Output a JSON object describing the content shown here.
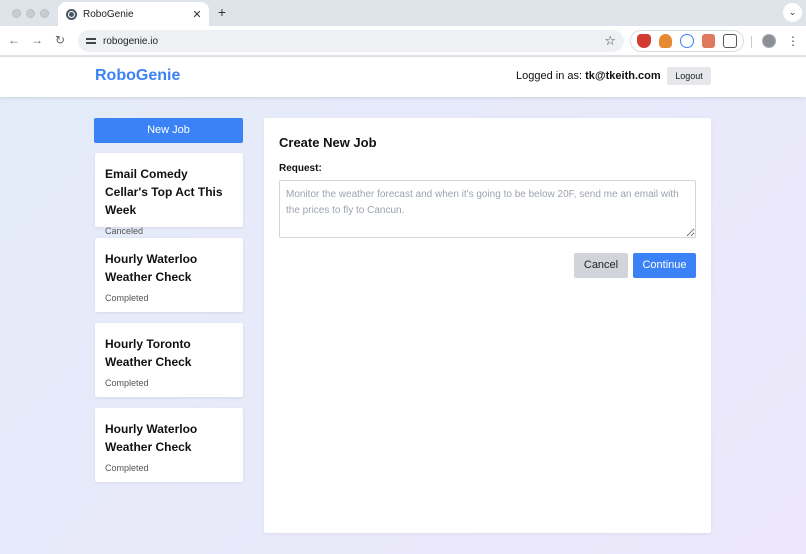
{
  "browser": {
    "tab_title": "RoboGenie",
    "tab_close": "✕",
    "new_tab": "+",
    "tab_menu": "⌄",
    "url": "robogenie.io",
    "back": "←",
    "forward": "→",
    "reload": "↻",
    "star": "☆",
    "menu": "⋮"
  },
  "header": {
    "brand": "RoboGenie",
    "logged_in_label": "Logged in as: ",
    "user_email": "tk@tkeith.com",
    "logout_label": "Logout"
  },
  "sidebar": {
    "new_job_label": "New Job",
    "jobs": [
      {
        "title": "Email Comedy Cellar's Top Act This Week",
        "status": "Canceled"
      },
      {
        "title": "Hourly Waterloo Weather Check",
        "status": "Completed"
      },
      {
        "title": "Hourly Toronto Weather Check",
        "status": "Completed"
      },
      {
        "title": "Hourly Waterloo Weather Check",
        "status": "Completed"
      }
    ]
  },
  "main": {
    "title": "Create New Job",
    "request_label": "Request:",
    "request_placeholder": "Monitor the weather forecast and when it's going to be below 20F, send me an email with the prices to fly to Cancun.",
    "request_value": "",
    "cancel_label": "Cancel",
    "continue_label": "Continue"
  }
}
